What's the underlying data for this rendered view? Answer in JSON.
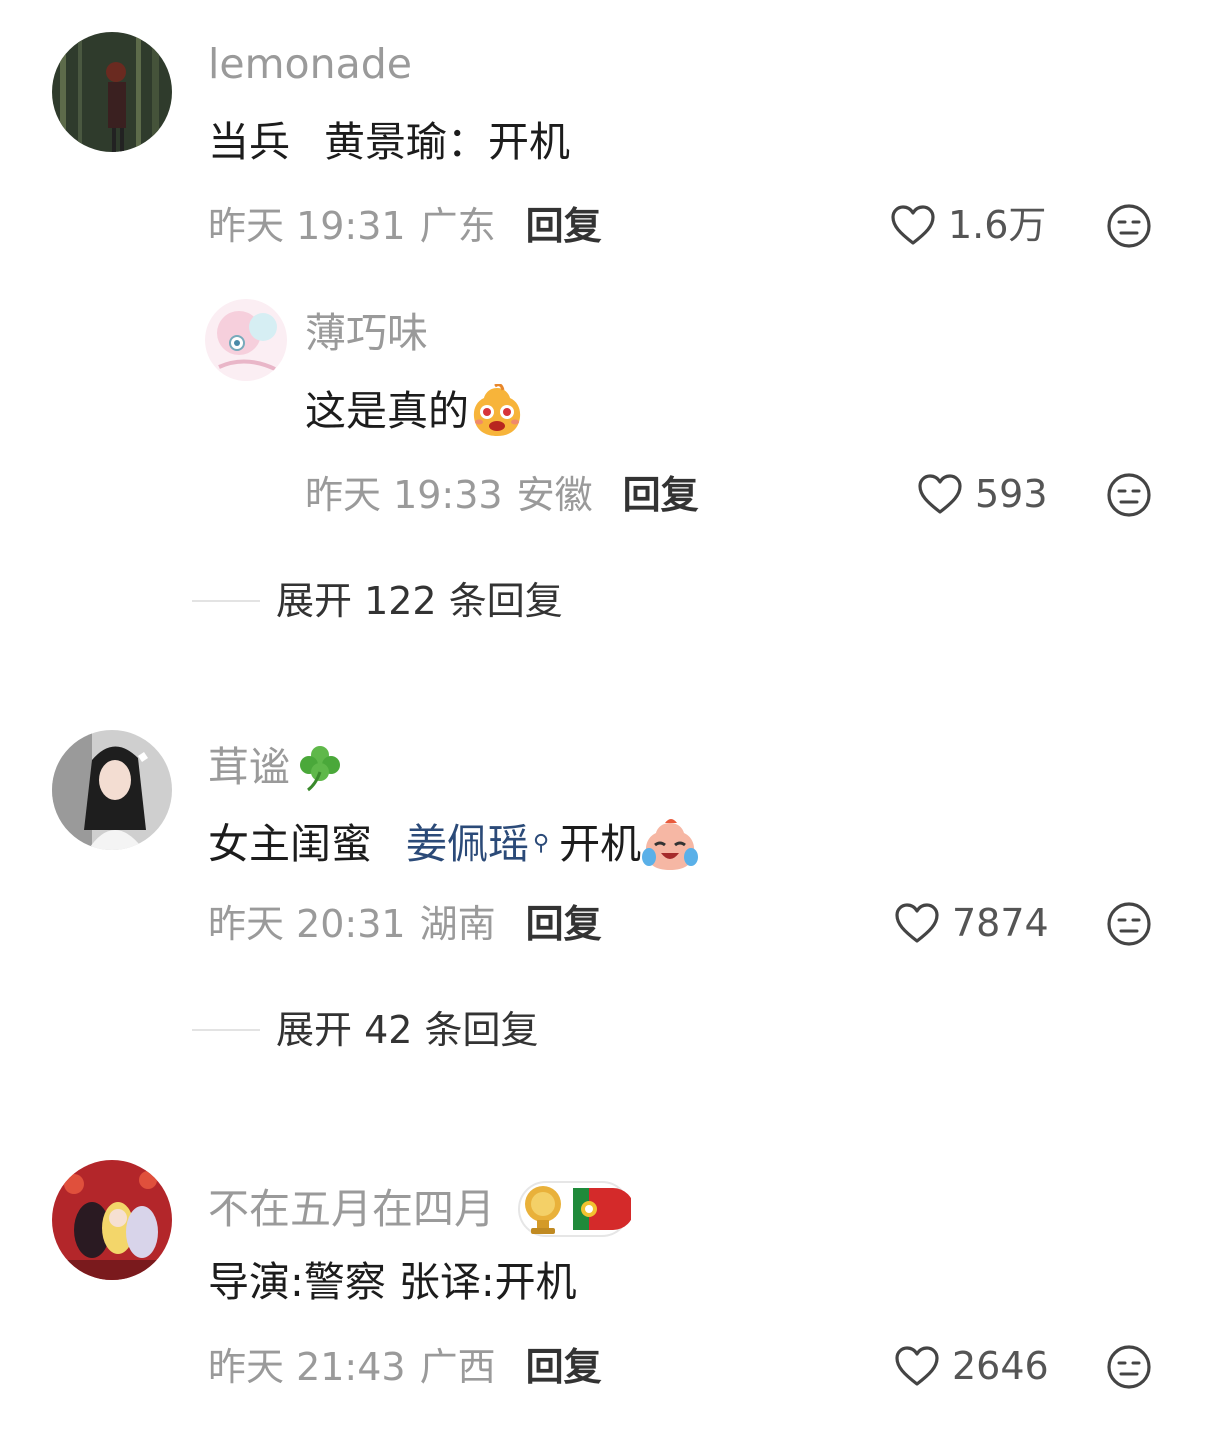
{
  "comments": [
    {
      "username": "lemonade",
      "content_a": "当兵",
      "content_b": "黄景瑜：开机",
      "time": "昨天 19:31",
      "location": "广东",
      "reply_label": "回复",
      "likes": "1.6万",
      "replies": [
        {
          "username": "薄巧味",
          "content": "这是真的",
          "emoji": "surprised-face-emoji",
          "time": "昨天 19:33",
          "location": "安徽",
          "reply_label": "回复",
          "likes": "593"
        }
      ],
      "expand_label": "展开 122 条回复"
    },
    {
      "username": "茸谧",
      "username_icon": "clover-icon",
      "content_a": "女主闺蜜",
      "mention": "姜佩瑶",
      "content_b": "开机",
      "emoji": "crying-laugh-emoji",
      "time": "昨天 20:31",
      "location": "湖南",
      "reply_label": "回复",
      "likes": "7874",
      "expand_label": "展开 42 条回复"
    },
    {
      "username": "不在五月在四月",
      "username_badge": "portugal-trophy-badge",
      "content": "导演:警察 张译:开机",
      "time": "昨天 21:43",
      "location": "广西",
      "reply_label": "回复",
      "likes": "2646"
    }
  ],
  "colors": {
    "secondary_text": "#9a9a9a",
    "primary_text": "#1c1c1c",
    "mention": "#2b4a78",
    "divider": "#e3e3e3"
  }
}
